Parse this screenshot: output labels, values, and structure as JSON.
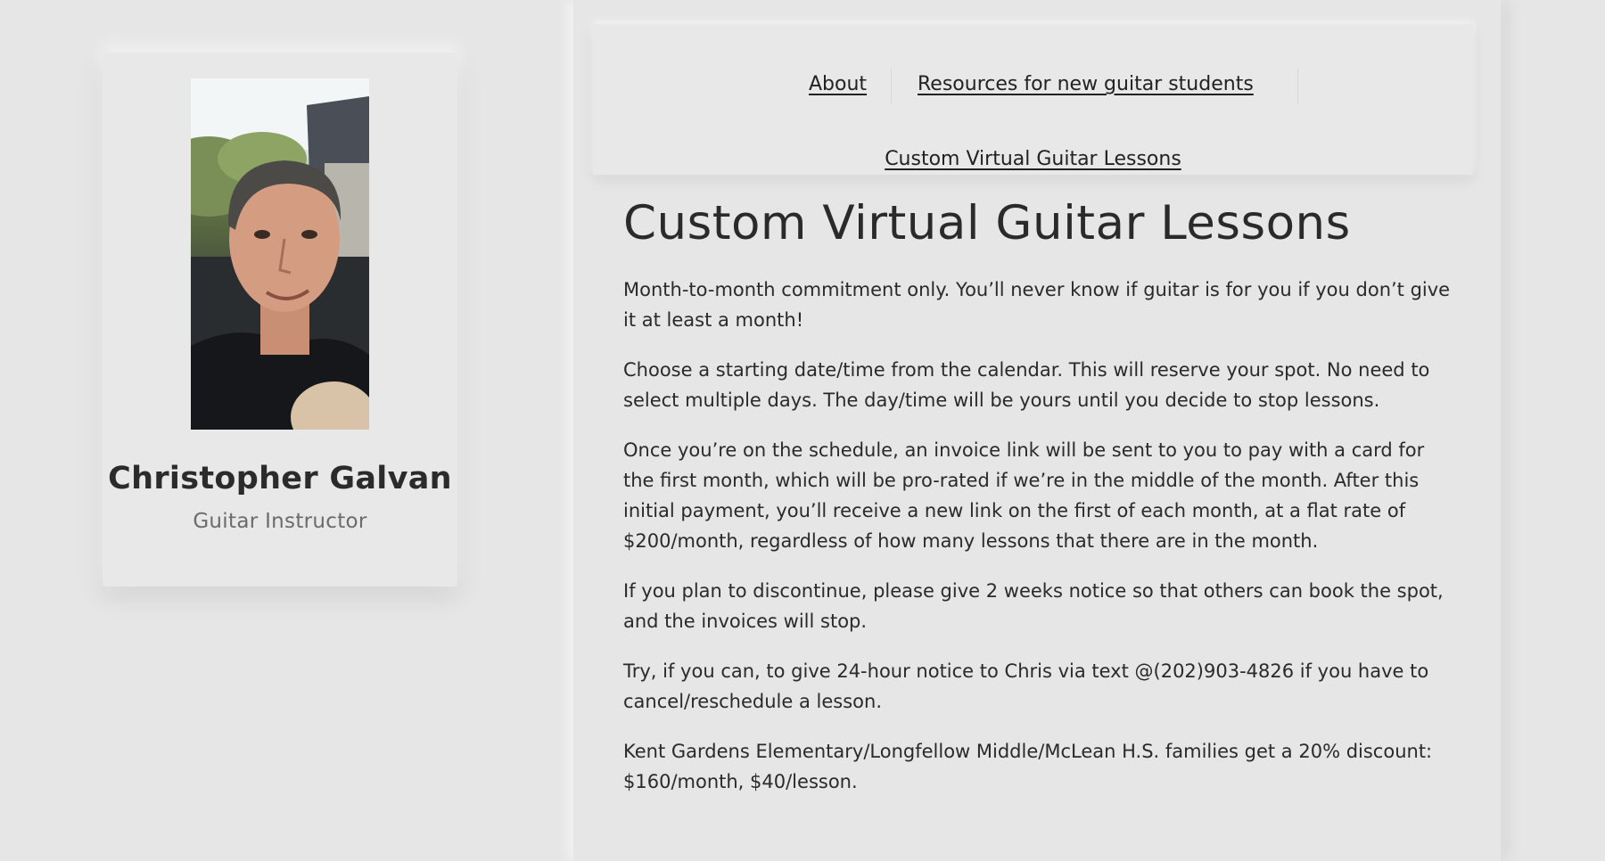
{
  "profile": {
    "name": "Christopher Galvan",
    "role": "Guitar Instructor",
    "photo_alt": "Portrait of Christopher Galvan"
  },
  "nav": {
    "items": [
      {
        "label": "About"
      },
      {
        "label": "Resources for new guitar students"
      },
      {
        "label": "Custom Virtual Guitar Lessons"
      }
    ]
  },
  "main": {
    "title": "Custom Virtual Guitar Lessons",
    "paragraphs": [
      "Month-to-month commitment only. You’ll never know if guitar is for you if you don’t give it at least a month!",
      "Choose a starting date/time from the calendar. This will reserve your spot. No need to select multiple days. The day/time will be yours until you decide to stop lessons.",
      "Once you’re on the schedule, an invoice link will be sent to you to pay with a card for the first month, which will be pro-rated if we’re in the middle of the month. After this initial payment, you’ll receive a new link on the first of each month, at a flat rate of $200/month, regardless of how many lessons that there are in the month.",
      "If you plan to discontinue, please give 2 weeks notice so that others can book the spot, and the invoices will stop.",
      "Try, if you can, to give 24-hour notice to Chris via text @(202)903-4826 if you have to cancel/reschedule a lesson.",
      "Kent Gardens Elementary/Longfellow Middle/McLean H.S. families get a 20% discount: $160/month, $40/lesson."
    ]
  },
  "colors": {
    "background": "#e6e6e6",
    "text": "#2a2a2a",
    "muted": "#6b6b6b"
  }
}
